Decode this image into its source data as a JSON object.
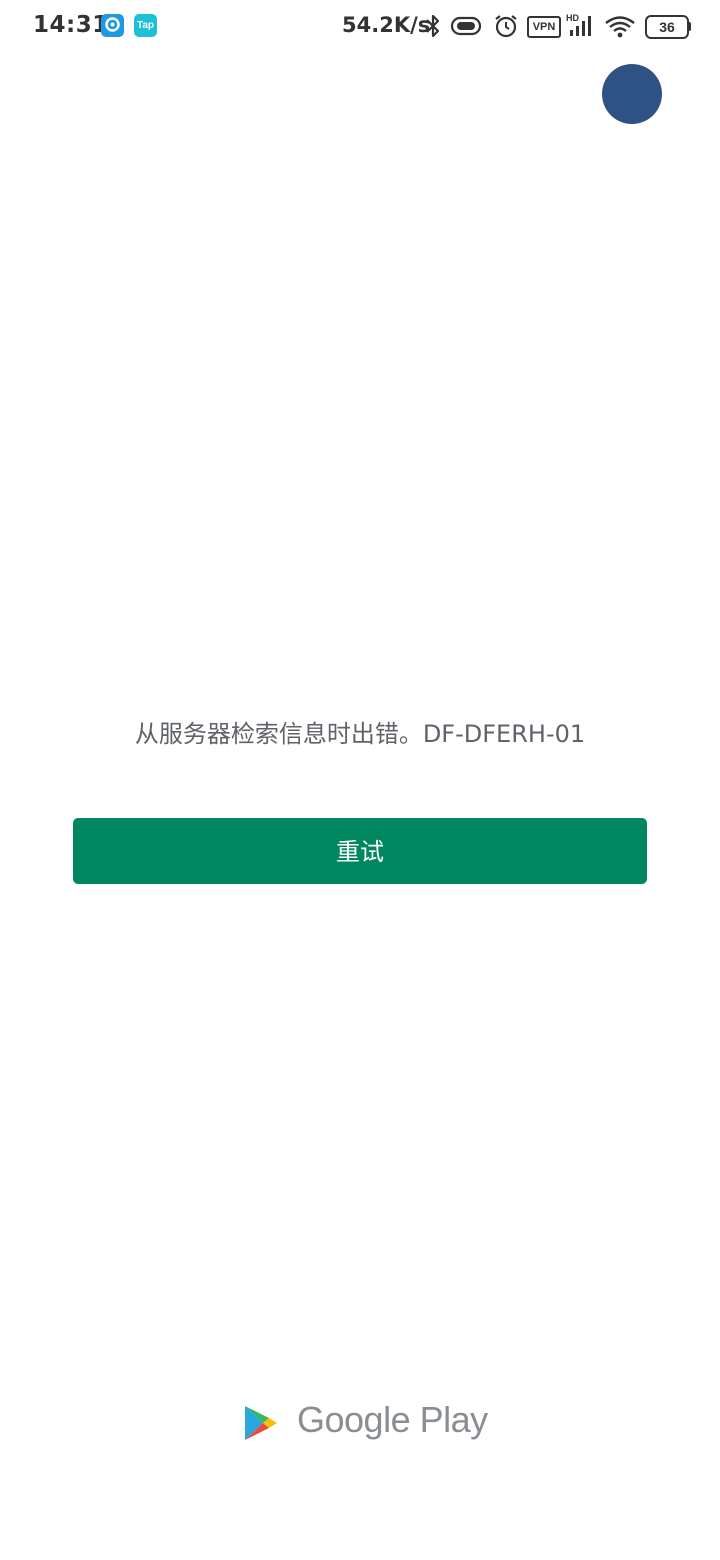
{
  "status_bar": {
    "time": "14:31",
    "app_icon_2_label": "Tap",
    "net_speed": "54.2K/s",
    "vpn_label": "VPN",
    "hd_label": "HD",
    "battery_level": "36"
  },
  "error": {
    "message": "从服务器检索信息时出错。DF-DFERH-01"
  },
  "actions": {
    "retry_label": "重试"
  },
  "branding": {
    "wordmark": "Google Play"
  },
  "colors": {
    "retry_button": "#01875f",
    "avatar": "#2e5283",
    "message_text": "#5f6368"
  }
}
